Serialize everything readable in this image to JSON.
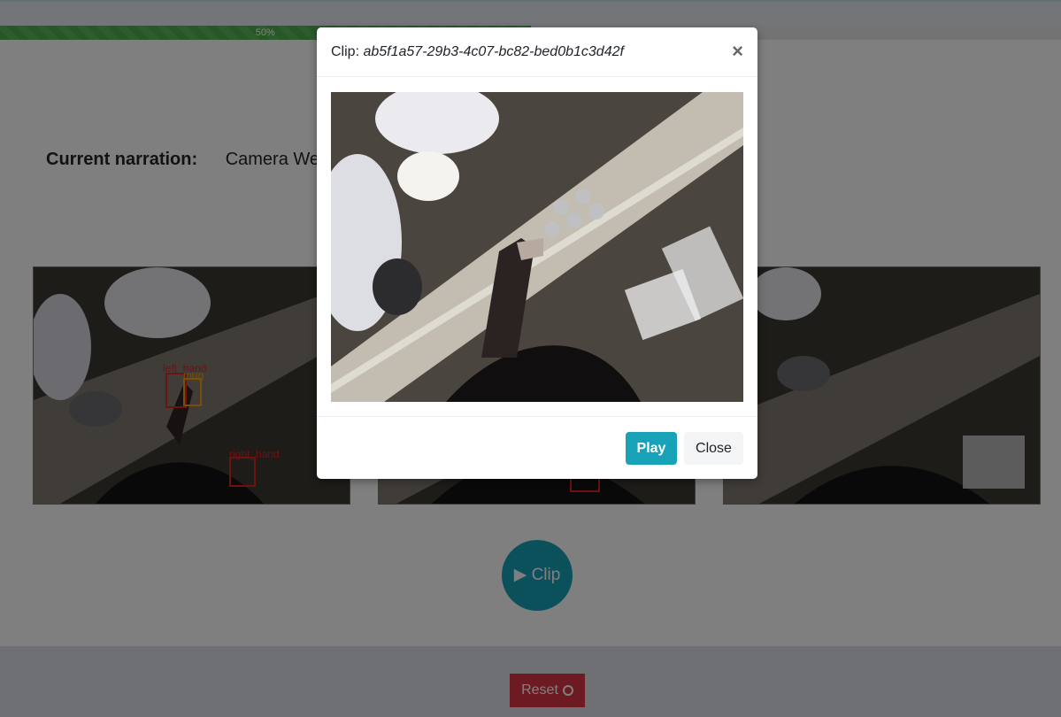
{
  "progress": {
    "value_percent": 50,
    "label": "50%",
    "fill_color": "#5cb85c"
  },
  "narration": {
    "label": "Current narration:",
    "text": "Camera We"
  },
  "frames": [
    {
      "name": "frame-1",
      "labels": [
        "left_hand",
        "mug",
        "right_hand"
      ]
    },
    {
      "name": "frame-2",
      "labels": []
    },
    {
      "name": "frame-3",
      "labels": []
    }
  ],
  "clip_button": {
    "icon": "play-icon",
    "label": "▶ Clip"
  },
  "reset_button": {
    "label": "Reset",
    "icon": "close-circle-icon",
    "color": "#dc3545"
  },
  "modal": {
    "title_prefix": "Clip:",
    "clip_id": "ab5f1a57-29b3-4c07-bc82-bed0b1c3d42f",
    "close_glyph": "×",
    "play_label": "Play",
    "close_label": "Close",
    "accent": "#17a2b8"
  }
}
